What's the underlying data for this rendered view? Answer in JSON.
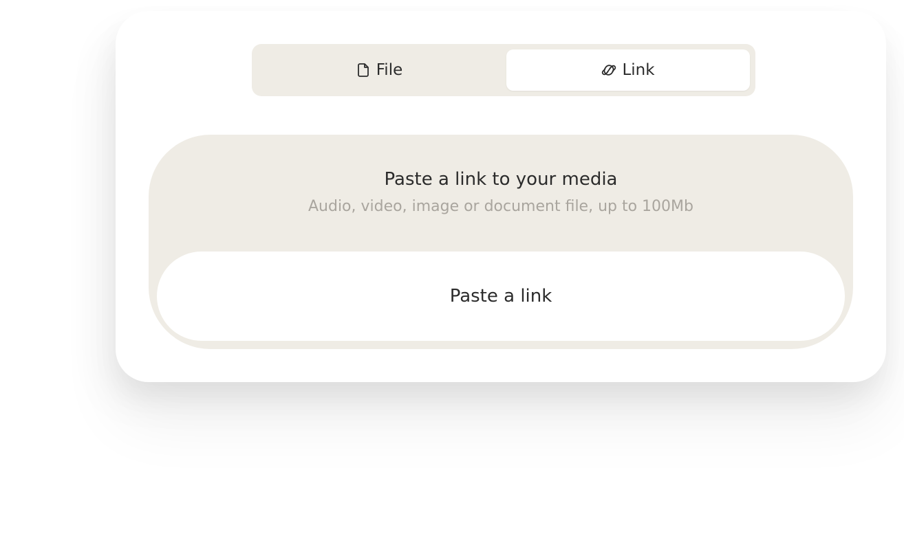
{
  "tabs": {
    "items": [
      {
        "label": "File",
        "icon": "file-icon",
        "active": false
      },
      {
        "label": "Link",
        "icon": "link-icon",
        "active": true
      }
    ]
  },
  "dropzone": {
    "title": "Paste a link to your media",
    "subtitle": "Audio, video, image or document file, up to 100Mb",
    "input_placeholder": "Paste a link"
  },
  "colors": {
    "panel_beige": "#efece5",
    "text_dark": "#2b2b2b",
    "text_muted": "#a9a59e",
    "surface": "#ffffff"
  }
}
